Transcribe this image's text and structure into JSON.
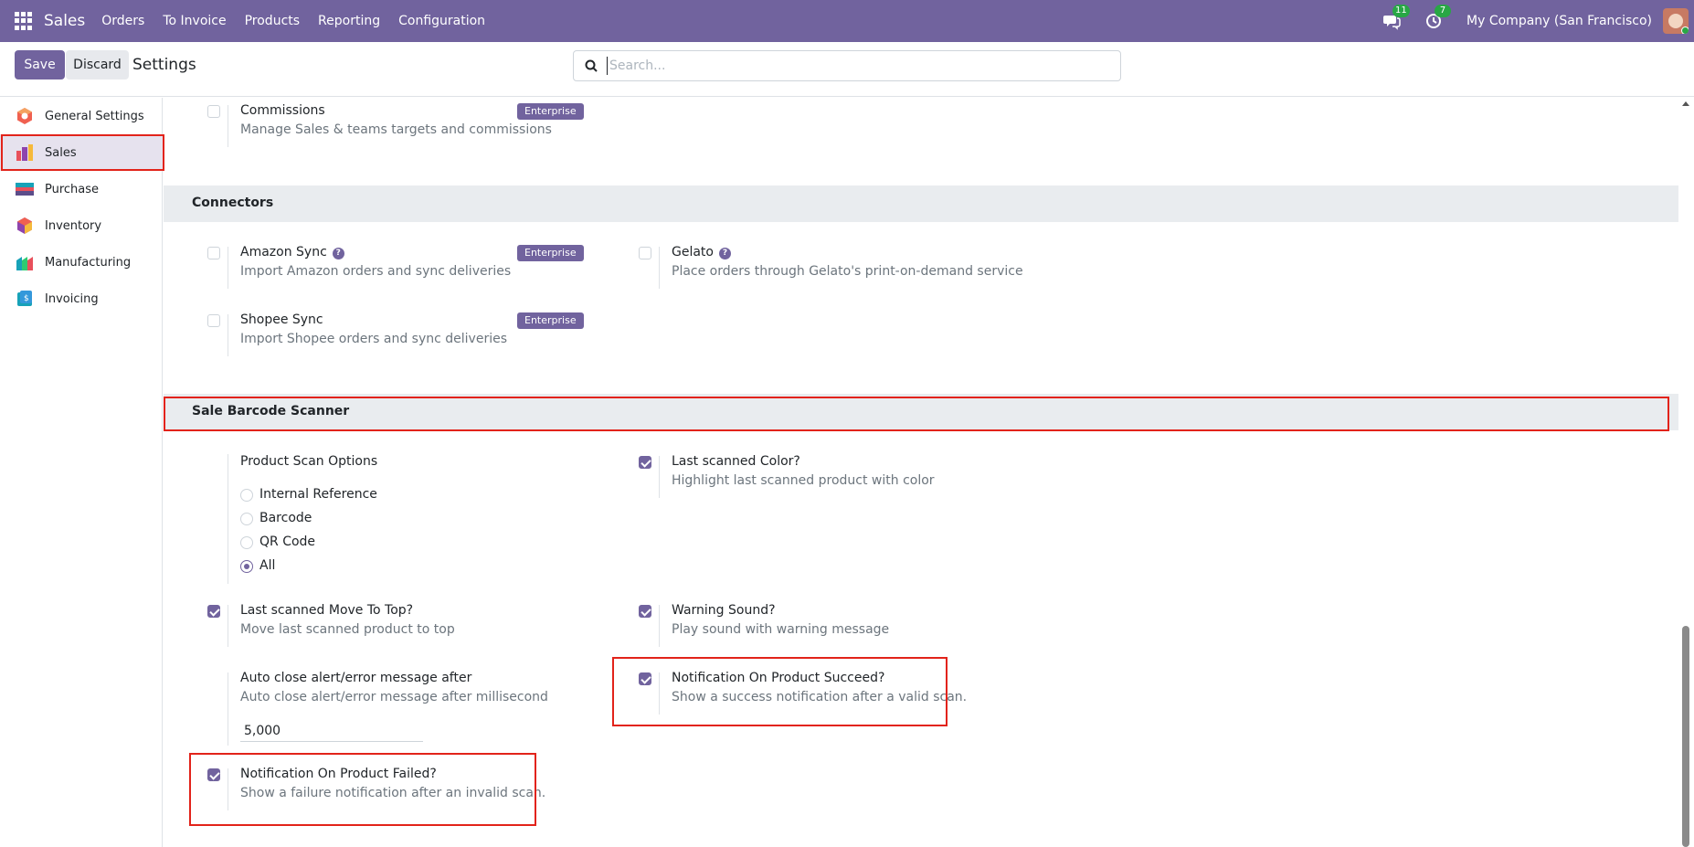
{
  "navbar": {
    "brand": "Sales",
    "menu": [
      "Orders",
      "To Invoice",
      "Products",
      "Reporting",
      "Configuration"
    ],
    "messages_count": "11",
    "activities_count": "7",
    "company": "My Company (San Francisco)"
  },
  "control": {
    "save_label": "Save",
    "discard_label": "Discard",
    "title": "Settings",
    "search_placeholder": "Search..."
  },
  "sidebar": {
    "items": [
      {
        "label": "General Settings",
        "icon": "general-settings-icon"
      },
      {
        "label": "Sales",
        "icon": "sales-icon"
      },
      {
        "label": "Purchase",
        "icon": "purchase-icon"
      },
      {
        "label": "Inventory",
        "icon": "inventory-icon"
      },
      {
        "label": "Manufacturing",
        "icon": "manufacturing-icon"
      },
      {
        "label": "Invoicing",
        "icon": "invoicing-icon"
      }
    ],
    "active": "Sales"
  },
  "enterprise_label": "Enterprise",
  "commissions": {
    "title": "Commissions",
    "desc": "Manage Sales & teams targets and commissions",
    "checked": false
  },
  "connectors": {
    "heading": "Connectors",
    "amazon": {
      "title": "Amazon Sync",
      "desc": "Import Amazon orders and sync deliveries",
      "checked": false
    },
    "gelato": {
      "title": "Gelato",
      "desc": "Place orders through Gelato's print-on-demand service",
      "checked": false
    },
    "shopee": {
      "title": "Shopee Sync",
      "desc": "Import Shopee orders and sync deliveries",
      "checked": false
    }
  },
  "barcode": {
    "heading": "Sale Barcode Scanner",
    "scan_options": {
      "title": "Product Scan Options",
      "options": [
        "Internal Reference",
        "Barcode",
        "QR Code",
        "All"
      ],
      "selected": "All"
    },
    "last_color": {
      "title": "Last scanned Color?",
      "desc": "Highlight last scanned product with color",
      "checked": true
    },
    "move_top": {
      "title": "Last scanned Move To Top?",
      "desc": "Move last scanned product to top",
      "checked": true
    },
    "warning_sound": {
      "title": "Warning Sound?",
      "desc": "Play sound with warning message",
      "checked": true
    },
    "auto_close": {
      "title": "Auto close alert/error message after",
      "desc": "Auto close alert/error message after millisecond",
      "value": "5,000"
    },
    "notif_succeed": {
      "title": "Notification On Product Succeed?",
      "desc": "Show a success notification after a valid scan.",
      "checked": true
    },
    "notif_failed": {
      "title": "Notification On Product Failed?",
      "desc": "Show a failure notification after an invalid scan.",
      "checked": true
    }
  },
  "colors": {
    "primary": "#71639e",
    "highlight": "#e2231a",
    "badge_green": "#28a745"
  }
}
